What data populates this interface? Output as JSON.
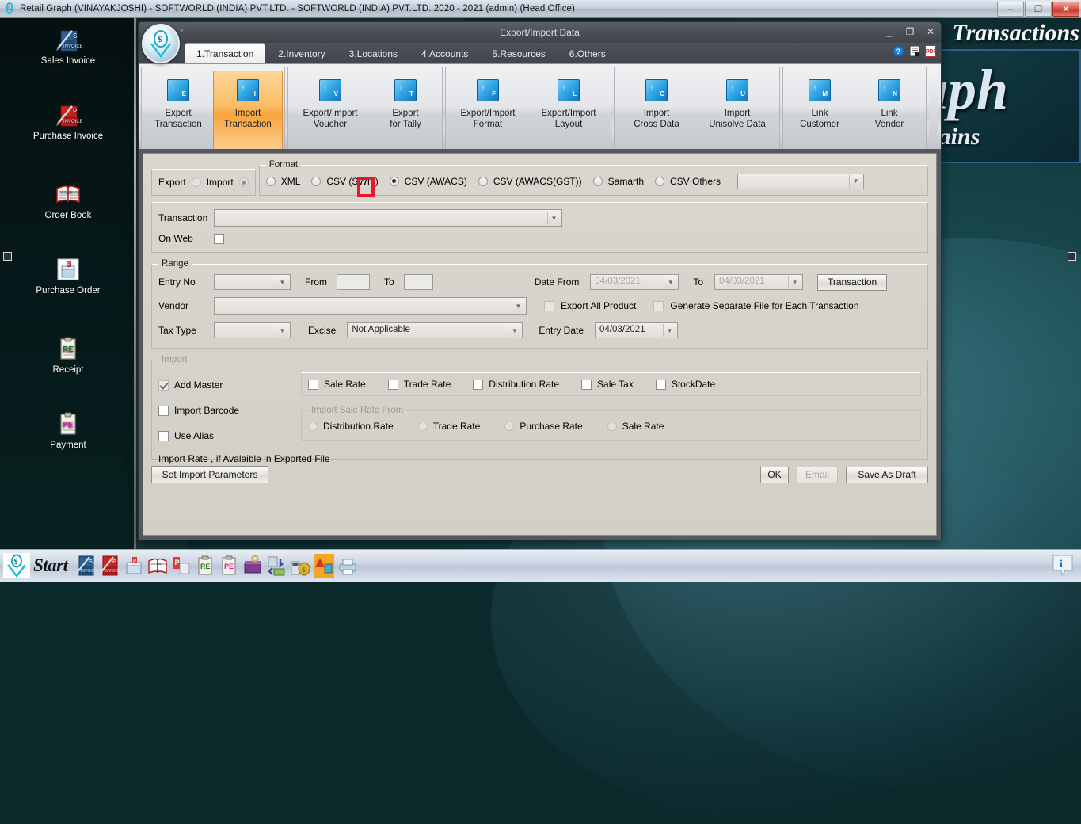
{
  "window": {
    "title": "Retail Graph (VINAYAKJOSHI) - SOFTWORLD (INDIA) PVT.LTD. - SOFTWORLD (INDIA) PVT.LTD.  2020 - 2021 (admin) (Head Office)",
    "icon": "app-logo-icon",
    "controls": {
      "minimize": "–",
      "restore": "❐",
      "close": "✕"
    }
  },
  "desktop": {
    "icons": [
      {
        "label": "Sales Invoice",
        "icon": "sales-invoice-icon"
      },
      {
        "label": "Purchase Invoice",
        "icon": "purchase-invoice-icon"
      },
      {
        "label": "Order Book",
        "icon": "order-book-icon"
      },
      {
        "label": "Purchase Order",
        "icon": "purchase-order-icon"
      },
      {
        "label": "Receipt",
        "icon": "receipt-icon"
      },
      {
        "label": "Payment",
        "icon": "payment-icon"
      }
    ],
    "backdrop": {
      "word_top": "Transactions",
      "plate_big": "aph",
      "plate_small": "hains"
    }
  },
  "taskbar": {
    "start_label": "Start",
    "start_icon": "windows-start-icon",
    "quick_icons": [
      "sales-invoice-icon",
      "purchase-invoice-icon",
      "cash-register-icon",
      "order-book-icon",
      "purchase-order-icon",
      "receipt-icon",
      "payment-icon",
      "ledger-icon",
      "cash-flow-icon",
      "calculator-money-icon",
      "report-chart-icon",
      "printer-icon"
    ],
    "tray_icon": "information-balloon-icon"
  },
  "dialog": {
    "title": "Export/Import Data",
    "qat_icon": "quick-access-toolbar-icon",
    "logo_icon": "retail-graph-logo-icon",
    "controls": {
      "minimize": "_",
      "maximize": "❐",
      "close": "✕"
    },
    "header_icons": [
      "help-icon",
      "document-icon",
      "pdf-export-icon"
    ],
    "tabs": [
      {
        "label": "1.Transaction",
        "active": true
      },
      {
        "label": "2.Inventory",
        "active": false
      },
      {
        "label": "3.Locations",
        "active": false
      },
      {
        "label": "4.Accounts",
        "active": false
      },
      {
        "label": "5.Resources",
        "active": false
      },
      {
        "label": "6.Others",
        "active": false
      }
    ],
    "ribbon_groups": [
      {
        "buttons": [
          {
            "line1": "Export",
            "line2": "Transaction",
            "icon": "export-transaction-icon",
            "badge": "E",
            "active": false
          },
          {
            "line1": "Import",
            "line2": "Transaction",
            "icon": "import-transaction-icon",
            "badge": "I",
            "active": true
          }
        ]
      },
      {
        "buttons": [
          {
            "line1": "Export/Import",
            "line2": "Voucher",
            "icon": "export-import-voucher-icon",
            "badge": "V",
            "active": false
          },
          {
            "line1": "Export",
            "line2": "for Tally",
            "icon": "export-for-tally-icon",
            "badge": "T",
            "active": false
          }
        ]
      },
      {
        "buttons": [
          {
            "line1": "Export/Import",
            "line2": "Format",
            "icon": "export-import-format-icon",
            "badge": "F",
            "active": false
          },
          {
            "line1": "Export/Import",
            "line2": "Layout",
            "icon": "export-import-layout-icon",
            "badge": "L",
            "active": false
          }
        ]
      },
      {
        "buttons": [
          {
            "line1": "Import",
            "line2": "Cross Data",
            "icon": "import-cross-data-icon",
            "badge": "C",
            "active": false
          },
          {
            "line1": "Import",
            "line2": "Unisolve Data",
            "icon": "import-unisolve-data-icon",
            "badge": "U",
            "active": false
          }
        ]
      },
      {
        "buttons": [
          {
            "line1": "Link",
            "line2": "Customer",
            "icon": "link-customer-icon",
            "badge": "M",
            "active": false
          },
          {
            "line1": "Link",
            "line2": "Vendor",
            "icon": "link-vendor-icon",
            "badge": "N",
            "active": false
          }
        ]
      }
    ]
  },
  "form": {
    "mode": {
      "export_label": "Export",
      "import_label": "Import",
      "export_selected": false,
      "import_selected": true
    },
    "format": {
      "legend": "Format",
      "options": [
        {
          "label": "XML",
          "selected": false
        },
        {
          "label": "CSV (SWIL)",
          "selected": false
        },
        {
          "label": "CSV (AWACS)",
          "selected": true,
          "highlighted": true
        },
        {
          "label": "CSV (AWACS(GST))",
          "selected": false
        },
        {
          "label": "Samarth",
          "selected": false
        },
        {
          "label": "CSV Others",
          "selected": false
        }
      ],
      "combo_value": ""
    },
    "transaction": {
      "label": "Transaction",
      "value": "",
      "on_web_label": "On Web",
      "on_web_checked": false
    },
    "range": {
      "legend": "Range",
      "entry_no_label": "Entry No",
      "entry_no_value": "",
      "from_label": "From",
      "from_value": "",
      "to_label": "To",
      "to_value": "",
      "date_from_label": "Date From",
      "date_from_value": "04/03/2021",
      "date_to_label": "To",
      "date_to_value": "04/03/2021",
      "transaction_button": "Transaction",
      "vendor_label": "Vendor",
      "vendor_value": "",
      "export_all_product_label": "Export All Product",
      "export_all_product_checked": false,
      "generate_separate_label": "Generate Separate File for Each Transaction",
      "generate_separate_checked": false,
      "tax_type_label": "Tax Type",
      "tax_type_value": "",
      "excise_label": "Excise",
      "excise_value": "Not Applicable",
      "entry_date_label": "Entry Date",
      "entry_date_value": "04/03/2021"
    },
    "import": {
      "legend": "Import",
      "add_master_label": "Add Master",
      "add_master_checked": true,
      "import_barcode_label": "Import Barcode",
      "import_barcode_checked": false,
      "use_alias_label": "Use Alias",
      "use_alias_checked": false,
      "rate_checkboxes": [
        {
          "label": "Sale Rate",
          "checked": false
        },
        {
          "label": "Trade Rate",
          "checked": false
        },
        {
          "label": "Distribution Rate",
          "checked": false
        },
        {
          "label": "Sale Tax",
          "checked": false
        },
        {
          "label": "StockDate",
          "checked": false
        }
      ],
      "sale_rate_from_legend": "Import Sale Rate From",
      "sale_rate_from_options": [
        {
          "label": "Distribution Rate",
          "selected": false
        },
        {
          "label": "Trade Rate",
          "selected": false
        },
        {
          "label": "Purchase Rate",
          "selected": false
        },
        {
          "label": "Sale Rate",
          "selected": false
        }
      ],
      "note": "Import Rate , if Avalaible in Exported File"
    },
    "actions": {
      "set_import_parameters": "Set Import Parameters",
      "ok": "OK",
      "email": "Email",
      "save_as_draft": "Save As Draft"
    }
  },
  "colors": {
    "accent_orange": "#f8a53e",
    "highlight_red": "#e8172c",
    "ribbon_icon_blue": "#1376bd",
    "desktop_teal": "#154145"
  }
}
